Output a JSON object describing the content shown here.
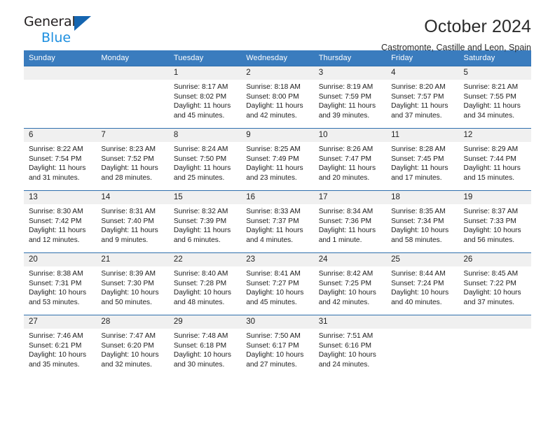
{
  "brand": {
    "word_general": "General",
    "word_blue": "Blue",
    "triangle_color": "#1565b0",
    "blue_text_color": "#1d8fe0"
  },
  "header": {
    "title": "October 2024",
    "subtitle": "Castromonte, Castille and Leon, Spain"
  },
  "theme": {
    "header_blue": "#3a7cbe",
    "row_line_blue": "#2f6fad",
    "daynum_bg": "#f0f0f0"
  },
  "weekdays": [
    "Sunday",
    "Monday",
    "Tuesday",
    "Wednesday",
    "Thursday",
    "Friday",
    "Saturday"
  ],
  "labels": {
    "sunrise_prefix": "Sunrise:",
    "sunset_prefix": "Sunset:",
    "daylight_prefix": "Daylight:"
  },
  "weeks": [
    [
      {
        "day": "",
        "lines": []
      },
      {
        "day": "",
        "lines": []
      },
      {
        "day": "1",
        "lines": [
          "Sunrise: 8:17 AM",
          "Sunset: 8:02 PM",
          "Daylight: 11 hours",
          "and 45 minutes."
        ]
      },
      {
        "day": "2",
        "lines": [
          "Sunrise: 8:18 AM",
          "Sunset: 8:00 PM",
          "Daylight: 11 hours",
          "and 42 minutes."
        ]
      },
      {
        "day": "3",
        "lines": [
          "Sunrise: 8:19 AM",
          "Sunset: 7:59 PM",
          "Daylight: 11 hours",
          "and 39 minutes."
        ]
      },
      {
        "day": "4",
        "lines": [
          "Sunrise: 8:20 AM",
          "Sunset: 7:57 PM",
          "Daylight: 11 hours",
          "and 37 minutes."
        ]
      },
      {
        "day": "5",
        "lines": [
          "Sunrise: 8:21 AM",
          "Sunset: 7:55 PM",
          "Daylight: 11 hours",
          "and 34 minutes."
        ]
      }
    ],
    [
      {
        "day": "6",
        "lines": [
          "Sunrise: 8:22 AM",
          "Sunset: 7:54 PM",
          "Daylight: 11 hours",
          "and 31 minutes."
        ]
      },
      {
        "day": "7",
        "lines": [
          "Sunrise: 8:23 AM",
          "Sunset: 7:52 PM",
          "Daylight: 11 hours",
          "and 28 minutes."
        ]
      },
      {
        "day": "8",
        "lines": [
          "Sunrise: 8:24 AM",
          "Sunset: 7:50 PM",
          "Daylight: 11 hours",
          "and 25 minutes."
        ]
      },
      {
        "day": "9",
        "lines": [
          "Sunrise: 8:25 AM",
          "Sunset: 7:49 PM",
          "Daylight: 11 hours",
          "and 23 minutes."
        ]
      },
      {
        "day": "10",
        "lines": [
          "Sunrise: 8:26 AM",
          "Sunset: 7:47 PM",
          "Daylight: 11 hours",
          "and 20 minutes."
        ]
      },
      {
        "day": "11",
        "lines": [
          "Sunrise: 8:28 AM",
          "Sunset: 7:45 PM",
          "Daylight: 11 hours",
          "and 17 minutes."
        ]
      },
      {
        "day": "12",
        "lines": [
          "Sunrise: 8:29 AM",
          "Sunset: 7:44 PM",
          "Daylight: 11 hours",
          "and 15 minutes."
        ]
      }
    ],
    [
      {
        "day": "13",
        "lines": [
          "Sunrise: 8:30 AM",
          "Sunset: 7:42 PM",
          "Daylight: 11 hours",
          "and 12 minutes."
        ]
      },
      {
        "day": "14",
        "lines": [
          "Sunrise: 8:31 AM",
          "Sunset: 7:40 PM",
          "Daylight: 11 hours",
          "and 9 minutes."
        ]
      },
      {
        "day": "15",
        "lines": [
          "Sunrise: 8:32 AM",
          "Sunset: 7:39 PM",
          "Daylight: 11 hours",
          "and 6 minutes."
        ]
      },
      {
        "day": "16",
        "lines": [
          "Sunrise: 8:33 AM",
          "Sunset: 7:37 PM",
          "Daylight: 11 hours",
          "and 4 minutes."
        ]
      },
      {
        "day": "17",
        "lines": [
          "Sunrise: 8:34 AM",
          "Sunset: 7:36 PM",
          "Daylight: 11 hours",
          "and 1 minute."
        ]
      },
      {
        "day": "18",
        "lines": [
          "Sunrise: 8:35 AM",
          "Sunset: 7:34 PM",
          "Daylight: 10 hours",
          "and 58 minutes."
        ]
      },
      {
        "day": "19",
        "lines": [
          "Sunrise: 8:37 AM",
          "Sunset: 7:33 PM",
          "Daylight: 10 hours",
          "and 56 minutes."
        ]
      }
    ],
    [
      {
        "day": "20",
        "lines": [
          "Sunrise: 8:38 AM",
          "Sunset: 7:31 PM",
          "Daylight: 10 hours",
          "and 53 minutes."
        ]
      },
      {
        "day": "21",
        "lines": [
          "Sunrise: 8:39 AM",
          "Sunset: 7:30 PM",
          "Daylight: 10 hours",
          "and 50 minutes."
        ]
      },
      {
        "day": "22",
        "lines": [
          "Sunrise: 8:40 AM",
          "Sunset: 7:28 PM",
          "Daylight: 10 hours",
          "and 48 minutes."
        ]
      },
      {
        "day": "23",
        "lines": [
          "Sunrise: 8:41 AM",
          "Sunset: 7:27 PM",
          "Daylight: 10 hours",
          "and 45 minutes."
        ]
      },
      {
        "day": "24",
        "lines": [
          "Sunrise: 8:42 AM",
          "Sunset: 7:25 PM",
          "Daylight: 10 hours",
          "and 42 minutes."
        ]
      },
      {
        "day": "25",
        "lines": [
          "Sunrise: 8:44 AM",
          "Sunset: 7:24 PM",
          "Daylight: 10 hours",
          "and 40 minutes."
        ]
      },
      {
        "day": "26",
        "lines": [
          "Sunrise: 8:45 AM",
          "Sunset: 7:22 PM",
          "Daylight: 10 hours",
          "and 37 minutes."
        ]
      }
    ],
    [
      {
        "day": "27",
        "lines": [
          "Sunrise: 7:46 AM",
          "Sunset: 6:21 PM",
          "Daylight: 10 hours",
          "and 35 minutes."
        ]
      },
      {
        "day": "28",
        "lines": [
          "Sunrise: 7:47 AM",
          "Sunset: 6:20 PM",
          "Daylight: 10 hours",
          "and 32 minutes."
        ]
      },
      {
        "day": "29",
        "lines": [
          "Sunrise: 7:48 AM",
          "Sunset: 6:18 PM",
          "Daylight: 10 hours",
          "and 30 minutes."
        ]
      },
      {
        "day": "30",
        "lines": [
          "Sunrise: 7:50 AM",
          "Sunset: 6:17 PM",
          "Daylight: 10 hours",
          "and 27 minutes."
        ]
      },
      {
        "day": "31",
        "lines": [
          "Sunrise: 7:51 AM",
          "Sunset: 6:16 PM",
          "Daylight: 10 hours",
          "and 24 minutes."
        ]
      },
      {
        "day": "",
        "lines": []
      },
      {
        "day": "",
        "lines": []
      }
    ]
  ]
}
